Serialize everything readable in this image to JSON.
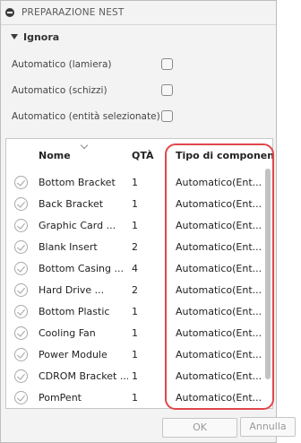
{
  "dialog": {
    "title": "PREPARAZIONE NEST",
    "group_label": "Ignora",
    "options": [
      {
        "label": "Automatico (lamiera)",
        "checked": false
      },
      {
        "label": "Automatico (schizzi)",
        "checked": false
      },
      {
        "label": "Automatico (entità selezionate)",
        "checked": false
      }
    ]
  },
  "table": {
    "headers": {
      "name": "Nome",
      "qty": "QTÀ",
      "type": "Tipo di componen"
    },
    "rows": [
      {
        "name": "Bottom Bracket",
        "qty": "1",
        "type": "Automatico(Ent..."
      },
      {
        "name": "Back Bracket",
        "qty": "1",
        "type": "Automatico(Ent..."
      },
      {
        "name": "Graphic Card ...",
        "qty": "1",
        "type": "Automatico(Ent..."
      },
      {
        "name": "Blank Insert",
        "qty": "2",
        "type": "Automatico(Ent..."
      },
      {
        "name": "Bottom Casing ...",
        "qty": "4",
        "type": "Automatico(Ent..."
      },
      {
        "name": "Hard Drive ...",
        "qty": "2",
        "type": "Automatico(Ent..."
      },
      {
        "name": "Bottom Plastic",
        "qty": "1",
        "type": "Automatico(Ent..."
      },
      {
        "name": "Cooling Fan",
        "qty": "1",
        "type": "Automatico(Ent..."
      },
      {
        "name": "Power Module",
        "qty": "1",
        "type": "Automatico(Ent..."
      },
      {
        "name": "CDROM Bracket ...",
        "qty": "1",
        "type": "Automatico(Ent..."
      },
      {
        "name": "PomPent",
        "qty": "1",
        "type": "Automatico(Ent..."
      }
    ]
  },
  "buttons": {
    "ok": "OK",
    "cancel": "Annulla"
  },
  "colors": {
    "highlight": "#e0474c",
    "panel": "#f3f3f3"
  }
}
